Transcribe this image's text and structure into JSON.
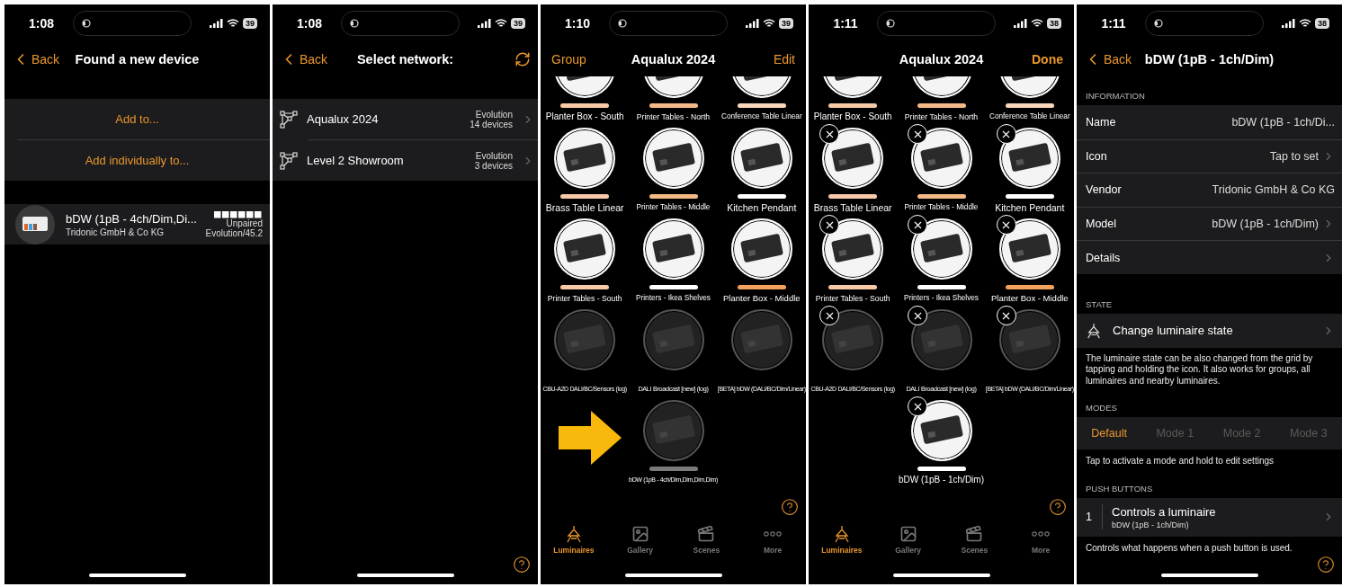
{
  "screens": [
    {
      "kind": "found",
      "status": {
        "time": "1:08",
        "battery": "39"
      },
      "nav": {
        "back": "Back",
        "title": "Found a new device"
      },
      "actions": [
        "Add to...",
        "Add individually to..."
      ],
      "device": {
        "name": "bDW (1pB - 4ch/Dim,Di...",
        "vendor": "Tridonic GmbH & Co KG",
        "state": "Unpaired",
        "firmware": "Evolution/45.2"
      }
    },
    {
      "kind": "networks",
      "status": {
        "time": "1:08",
        "battery": "39"
      },
      "nav": {
        "back": "Back",
        "title": "Select network:"
      },
      "networks": [
        {
          "name": "Aqualux 2024",
          "type": "Evolution",
          "devices": "14 devices"
        },
        {
          "name": "Level 2 Showroom",
          "type": "Evolution",
          "devices": "3 devices"
        }
      ]
    },
    {
      "kind": "grid",
      "status": {
        "time": "1:10",
        "battery": "39"
      },
      "nav": {
        "left": "Group",
        "title": "Aqualux 2024",
        "right": "Edit"
      },
      "editing": false,
      "pointer_arrow": true,
      "luminaires": [
        {
          "label": "Planter Box - South",
          "cut": true,
          "online": true,
          "color": "#f7c9a6"
        },
        {
          "label": "Printer Tables - North",
          "cut": true,
          "online": true,
          "color": "#f5b987"
        },
        {
          "label": "Conference Table Linear",
          "cut": true,
          "online": true,
          "color": "#f9d7bd"
        },
        {
          "label": "Brass Table Linear",
          "cut": false,
          "online": true,
          "color": "#f7c9a6"
        },
        {
          "label": "Printer Tables - Middle",
          "cut": false,
          "online": true,
          "color": "#f5b987"
        },
        {
          "label": "Kitchen Pendant",
          "cut": false,
          "online": true,
          "color": "#ffffff"
        },
        {
          "label": "Printer Tables - South",
          "cut": false,
          "online": true,
          "color": "#f7c9a6"
        },
        {
          "label": "Printers - Ikea Shelves",
          "cut": false,
          "online": true,
          "color": "#ffffff"
        },
        {
          "label": "Planter Box - Middle",
          "cut": false,
          "online": true,
          "color": "#f2a05c"
        },
        {
          "label": "CBU-A2D DALI/BC/Sensors (log)",
          "cut": false,
          "online": false
        },
        {
          "label": "DALI Broadcast [new] (log)",
          "cut": false,
          "online": false
        },
        {
          "label": "[BETA] bDW (DALI/BC/Dim/Linear)",
          "cut": false,
          "online": false
        },
        {
          "label": "bDW (1pB - 4ch/Dim,Dim,Dim,Dim)",
          "cut": false,
          "online": false,
          "color": "#7a7a7a"
        }
      ],
      "tabs": [
        {
          "label": "Luminaires",
          "selected": true
        },
        {
          "label": "Gallery",
          "selected": false
        },
        {
          "label": "Scenes",
          "selected": false
        },
        {
          "label": "More",
          "selected": false
        }
      ]
    },
    {
      "kind": "grid",
      "status": {
        "time": "1:11",
        "battery": "38"
      },
      "nav": {
        "title": "Aqualux 2024",
        "right": "Done"
      },
      "editing": true,
      "pointer_arrow": false,
      "luminaires": [
        {
          "label": "Planter Box - South",
          "cut": true,
          "online": true,
          "color": "#f7c9a6"
        },
        {
          "label": "Printer Tables - North",
          "cut": true,
          "online": true,
          "color": "#f5b987"
        },
        {
          "label": "Conference Table Linear",
          "cut": true,
          "online": true,
          "color": "#f9d7bd"
        },
        {
          "label": "Brass Table Linear",
          "cut": false,
          "online": true,
          "color": "#f7c9a6"
        },
        {
          "label": "Printer Tables - Middle",
          "cut": false,
          "online": true,
          "color": "#f5b987"
        },
        {
          "label": "Kitchen Pendant",
          "cut": false,
          "online": true,
          "color": "#ffffff"
        },
        {
          "label": "Printer Tables - South",
          "cut": false,
          "online": true,
          "color": "#f7c9a6"
        },
        {
          "label": "Printers - Ikea Shelves",
          "cut": false,
          "online": true,
          "color": "#ffffff"
        },
        {
          "label": "Planter Box - Middle",
          "cut": false,
          "online": true,
          "color": "#f2a05c"
        },
        {
          "label": "CBU-A2D DALI/BC/Sensors (log)",
          "cut": false,
          "online": false
        },
        {
          "label": "DALI Broadcast [new] (log)",
          "cut": false,
          "online": false
        },
        {
          "label": "[BETA] bDW (DALI/BC/Dim/Linear)",
          "cut": false,
          "online": false
        },
        {
          "label": "bDW (1pB - 1ch/Dim)",
          "cut": false,
          "online": true,
          "color": "#ffffff"
        }
      ],
      "tabs": [
        {
          "label": "Luminaires",
          "selected": true
        },
        {
          "label": "Gallery",
          "selected": false
        },
        {
          "label": "Scenes",
          "selected": false
        },
        {
          "label": "More",
          "selected": false
        }
      ]
    },
    {
      "kind": "detail",
      "status": {
        "time": "1:11",
        "battery": "38"
      },
      "nav": {
        "back": "Back",
        "title": "bDW (1pB - 1ch/Dim)"
      },
      "information": {
        "header": "INFORMATION",
        "rows": [
          {
            "label": "Name",
            "value": "bDW (1pB - 1ch/Di...",
            "chevron": false
          },
          {
            "label": "Icon",
            "value": "Tap to set",
            "chevron": true
          },
          {
            "label": "Vendor",
            "value": "Tridonic GmbH & Co KG",
            "chevron": false
          },
          {
            "label": "Model",
            "value": "bDW (1pB - 1ch/Dim)",
            "chevron": true
          },
          {
            "label": "Details",
            "chevron": true
          }
        ]
      },
      "state": {
        "header": "STATE",
        "action": "Change luminaire state",
        "note": "The luminaire state can be also changed from the grid by tapping and holding the icon. It also works for groups, all luminaires and nearby luminaires."
      },
      "modes": {
        "header": "MODES",
        "items": [
          {
            "label": "Default",
            "selected": true
          },
          {
            "label": "Mode 1",
            "selected": false
          },
          {
            "label": "Mode 2",
            "selected": false
          },
          {
            "label": "Mode 3",
            "selected": false
          }
        ],
        "note": "Tap to activate a mode and hold to edit settings"
      },
      "push_buttons": {
        "header": "PUSH BUTTONS",
        "items": [
          {
            "index": "1",
            "title": "Controls a luminaire",
            "subtitle": "bDW (1pB - 1ch/Dim)"
          }
        ],
        "note": "Controls what happens when a push button is used."
      }
    }
  ]
}
